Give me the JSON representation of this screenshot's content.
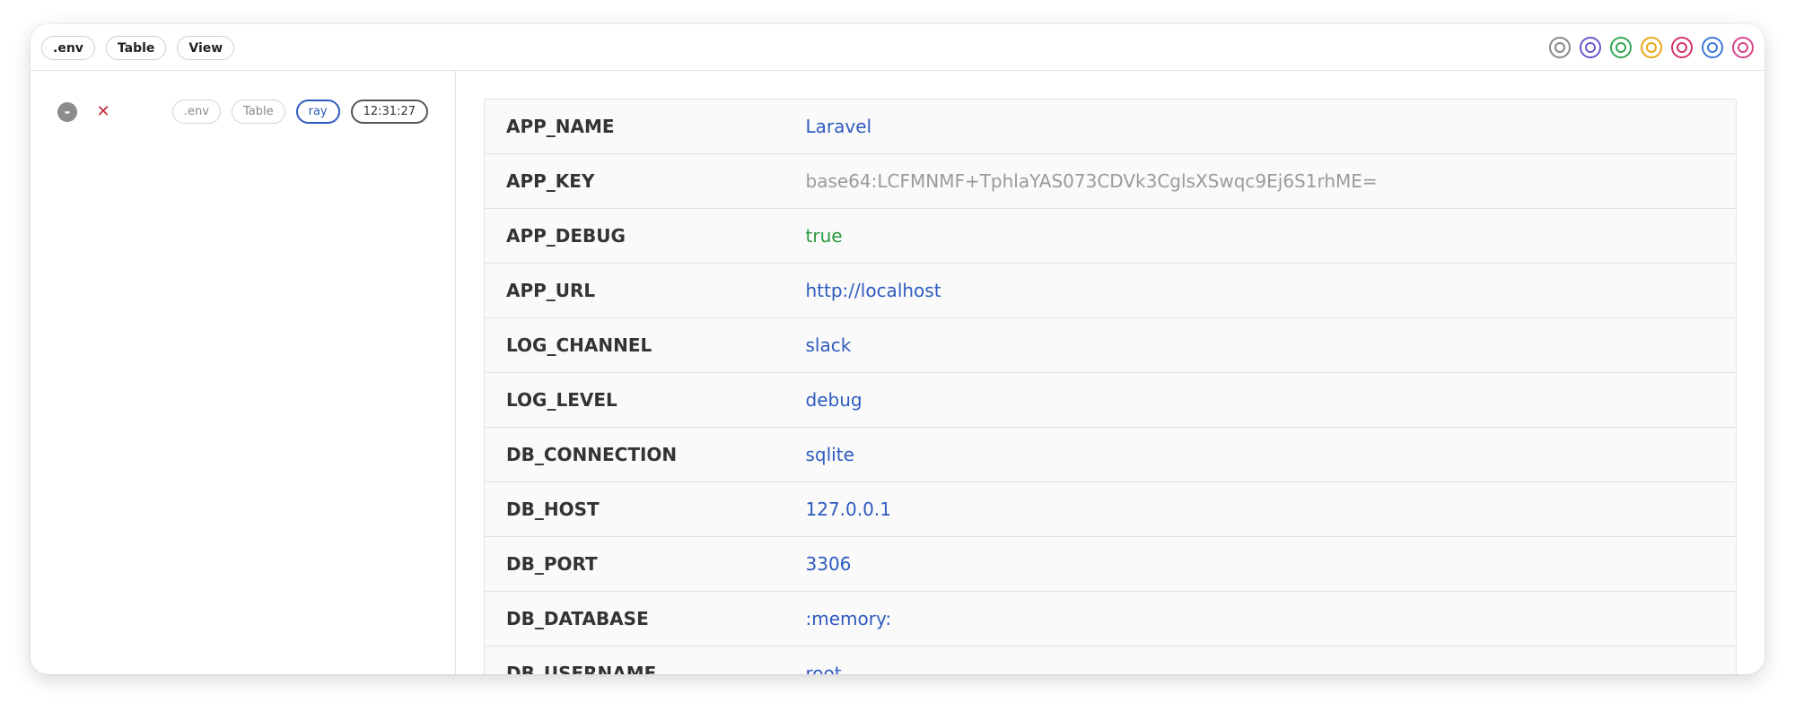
{
  "topbar": {
    "pills": [
      ".env",
      "Table",
      "View"
    ],
    "color_circles": [
      {
        "name": "gray",
        "color": "#888888"
      },
      {
        "name": "purple",
        "color": "#6a5acd"
      },
      {
        "name": "green",
        "color": "#34a853"
      },
      {
        "name": "orange",
        "color": "#e6a817"
      },
      {
        "name": "red",
        "color": "#d6336c"
      },
      {
        "name": "blue",
        "color": "#3a78d8"
      },
      {
        "name": "pink",
        "color": "#d6448a"
      }
    ]
  },
  "sidebar": {
    "entry": {
      "minus_label": "-",
      "close_label": "✕",
      "tags": [
        ".env",
        "Table"
      ],
      "origin": "ray",
      "time": "12:31:27"
    }
  },
  "table": {
    "rows": [
      {
        "key": "APP_NAME",
        "value": "Laravel",
        "style": "blue"
      },
      {
        "key": "APP_KEY",
        "value": "base64:LCFMNMF+TphlaYAS073CDVk3CglsXSwqc9Ej6S1rhME=",
        "style": "muted"
      },
      {
        "key": "APP_DEBUG",
        "value": "true",
        "style": "green"
      },
      {
        "key": "APP_URL",
        "value": "http://localhost",
        "style": "blue"
      },
      {
        "key": "LOG_CHANNEL",
        "value": "slack",
        "style": "blue"
      },
      {
        "key": "LOG_LEVEL",
        "value": "debug",
        "style": "blue"
      },
      {
        "key": "DB_CONNECTION",
        "value": "sqlite",
        "style": "blue"
      },
      {
        "key": "DB_HOST",
        "value": "127.0.0.1",
        "style": "blue"
      },
      {
        "key": "DB_PORT",
        "value": "3306",
        "style": "blue"
      },
      {
        "key": "DB_DATABASE",
        "value": ":memory:",
        "style": "blue"
      },
      {
        "key": "DB_USERNAME",
        "value": "root",
        "style": "blue"
      }
    ]
  },
  "colors": {
    "accent_blue": "#2e5bbf",
    "bool_green": "#2a9a3e",
    "muted_gray": "#9a9a9a",
    "close_red": "#c0283a"
  }
}
